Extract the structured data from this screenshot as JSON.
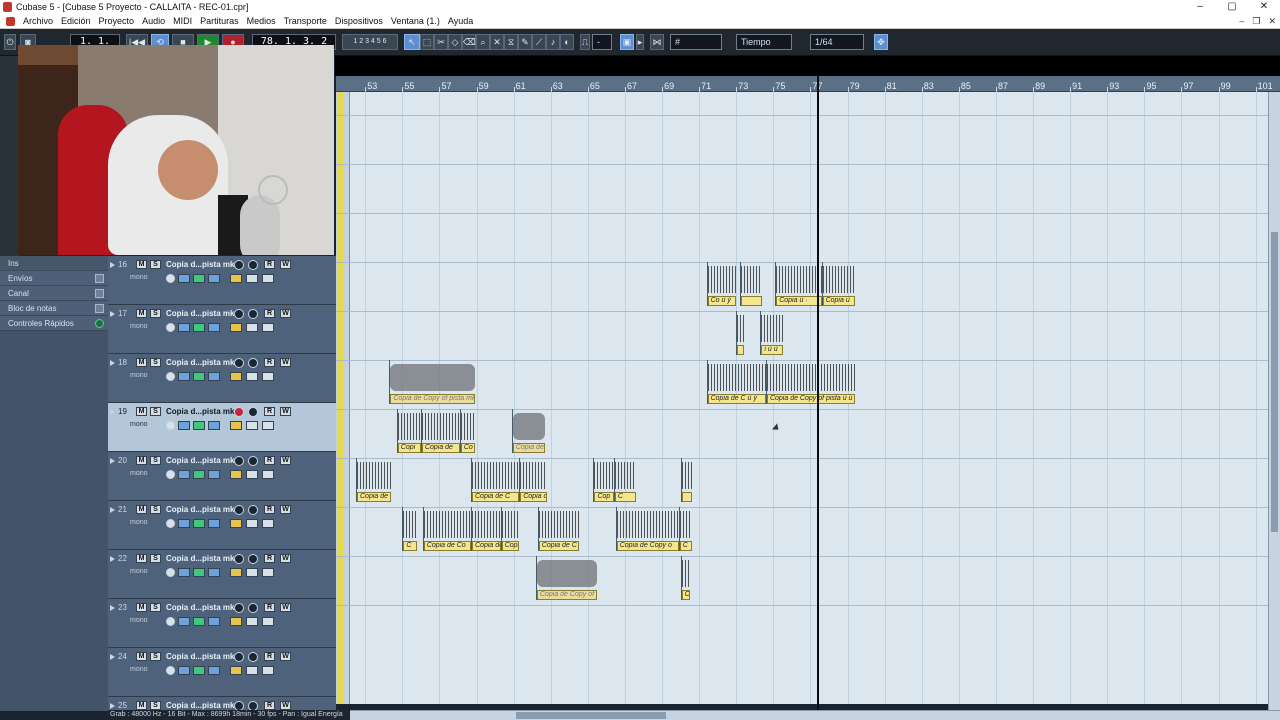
{
  "window": {
    "title": "Cubase 5 - [Cubase 5 Proyecto - CALLAITA - REC-01.cpr]"
  },
  "menu": [
    "Archivo",
    "Edición",
    "Proyecto",
    "Audio",
    "MIDI",
    "Partituras",
    "Medios",
    "Transporte",
    "Dispositivos",
    "Ventana (1.)",
    "Ayuda"
  ],
  "toolbar": {
    "position_left": "1. 1. 1. 0",
    "position_main": "78. 1. 3. 2",
    "snap_mode": "Tiempo",
    "quantize": "1/64",
    "grid_value": "-"
  },
  "inspector": {
    "top_labels": [
      "Nin",
      "Cop",
      "Ins",
      "Ec"
    ],
    "items": [
      "Envíos",
      "Canal",
      "Bloc de notas",
      "Controles Rápidos"
    ]
  },
  "tracks": [
    {
      "num": "16",
      "name": "Copia d...pista mk",
      "sub": "mono",
      "selected": false,
      "rec": false
    },
    {
      "num": "17",
      "name": "Copia d...pista mk",
      "sub": "mono",
      "selected": false,
      "rec": false
    },
    {
      "num": "18",
      "name": "Copia d...pista mk",
      "sub": "mono",
      "selected": false,
      "rec": false
    },
    {
      "num": "19",
      "name": "Copia d...pista mk",
      "sub": "mono",
      "selected": true,
      "rec": true
    },
    {
      "num": "20",
      "name": "Copia d...pista mk",
      "sub": "mono",
      "selected": false,
      "rec": false
    },
    {
      "num": "21",
      "name": "Copia d...pista mk",
      "sub": "mono",
      "selected": false,
      "rec": false
    },
    {
      "num": "22",
      "name": "Copia d...pista mk",
      "sub": "mono",
      "selected": false,
      "rec": false
    },
    {
      "num": "23",
      "name": "Copia d...pista mk",
      "sub": "mono",
      "selected": false,
      "rec": false
    },
    {
      "num": "24",
      "name": "Copia d...pista mk",
      "sub": "mono",
      "selected": false,
      "rec": false
    },
    {
      "num": "25",
      "name": "Copia d...pista mk",
      "sub": "mono",
      "selected": false,
      "rec": false
    }
  ],
  "ruler": [
    "53",
    "55",
    "57",
    "59",
    "61",
    "63",
    "65",
    "67",
    "69",
    "71",
    "73",
    "75",
    "77",
    "79",
    "81",
    "83",
    "85",
    "87",
    "89",
    "91",
    "93",
    "95",
    "97",
    "99",
    "101"
  ],
  "parts": [
    {
      "track": 0,
      "bar": 71.4,
      "len": 1.6,
      "label": "Co ù ý",
      "muted": false
    },
    {
      "track": 0,
      "bar": 73.2,
      "len": 1.2,
      "label": "",
      "muted": false
    },
    {
      "track": 0,
      "bar": 75.1,
      "len": 2.5,
      "label": "Copia ù ·",
      "muted": false
    },
    {
      "track": 0,
      "bar": 77.6,
      "len": 1.8,
      "label": "Copia ù",
      "muted": false
    },
    {
      "track": 1,
      "bar": 73.0,
      "len": 0.4,
      "label": "",
      "muted": false
    },
    {
      "track": 1,
      "bar": 74.3,
      "len": 1.2,
      "label": "i ù ù",
      "muted": false
    },
    {
      "track": 2,
      "bar": 54.3,
      "len": 4.6,
      "label": "Copia de Copy of pista mk",
      "muted": true
    },
    {
      "track": 2,
      "bar": 71.4,
      "len": 3.2,
      "label": "Copia de C ù ý",
      "muted": false
    },
    {
      "track": 2,
      "bar": 74.6,
      "len": 4.8,
      "label": "Copia de Copy of pista ù ù",
      "muted": false
    },
    {
      "track": 3,
      "bar": 54.7,
      "len": 1.3,
      "label": "Copi",
      "muted": false
    },
    {
      "track": 3,
      "bar": 56.0,
      "len": 2.1,
      "label": "Copia de",
      "muted": false
    },
    {
      "track": 3,
      "bar": 58.1,
      "len": 0.8,
      "label": "Co",
      "muted": false
    },
    {
      "track": 3,
      "bar": 60.9,
      "len": 1.8,
      "label": "Copia de",
      "muted": true
    },
    {
      "track": 4,
      "bar": 52.5,
      "len": 1.9,
      "label": "Copia de C",
      "muted": false
    },
    {
      "track": 4,
      "bar": 58.7,
      "len": 2.6,
      "label": "Copia de C",
      "muted": false
    },
    {
      "track": 4,
      "bar": 61.3,
      "len": 1.5,
      "label": "Copia de",
      "muted": false
    },
    {
      "track": 4,
      "bar": 65.3,
      "len": 1.1,
      "label": "Cop",
      "muted": false
    },
    {
      "track": 4,
      "bar": 66.4,
      "len": 1.2,
      "label": "C",
      "muted": false
    },
    {
      "track": 4,
      "bar": 70.0,
      "len": 0.6,
      "label": "",
      "muted": false
    },
    {
      "track": 5,
      "bar": 55.0,
      "len": 0.8,
      "label": "C",
      "muted": false
    },
    {
      "track": 5,
      "bar": 56.1,
      "len": 2.6,
      "label": "Copia de Co",
      "muted": false
    },
    {
      "track": 5,
      "bar": 58.7,
      "len": 1.6,
      "label": "Copia de",
      "muted": false
    },
    {
      "track": 5,
      "bar": 60.3,
      "len": 1.0,
      "label": "Copi",
      "muted": false
    },
    {
      "track": 5,
      "bar": 62.3,
      "len": 2.2,
      "label": "Copia de C",
      "muted": false
    },
    {
      "track": 5,
      "bar": 66.5,
      "len": 3.4,
      "label": "Copia de Copy o",
      "muted": false
    },
    {
      "track": 5,
      "bar": 69.9,
      "len": 0.7,
      "label": "C",
      "muted": false
    },
    {
      "track": 6,
      "bar": 62.2,
      "len": 3.3,
      "label": "Copia de Copy of p",
      "muted": true
    },
    {
      "track": 6,
      "bar": 70.0,
      "len": 0.5,
      "label": "C",
      "muted": false
    }
  ],
  "status": "Grab : 48000 Hz - 16 Bit - Max : 8699h 18min - 30 fps - Pan : Igual Energía"
}
